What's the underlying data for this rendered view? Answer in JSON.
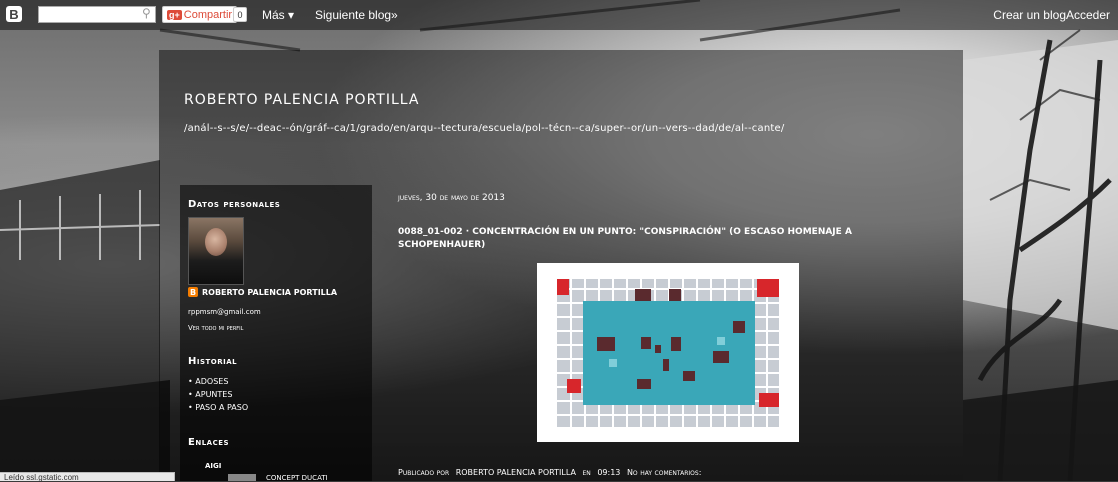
{
  "navbar": {
    "logo": "B",
    "search_placeholder": "",
    "share_label": "Compartir",
    "share_icon": "g+",
    "share_count": "0",
    "more_label": "Más ▾",
    "next_blog": "Siguiente blog»",
    "create_blog": "Crear un blog",
    "login": "Acceder"
  },
  "header": {
    "title": "ROBERTO PALENCIA PORTILLA",
    "description": "/anál--s--s/e/--deac--ón/gráf--ca/1/grado/en/arqu--tectura/escuela/pol--técn--ca/super--or/un--vers--dad/de/al--cante/"
  },
  "sidebar": {
    "profile_heading": "Datos personales",
    "profile_name": "ROBERTO PALENCIA PORTILLA",
    "profile_email": "rppmsm@gmail.com",
    "profile_link": "Ver todo mi perfil",
    "history_heading": "Historial",
    "history_items": [
      "ADOSES",
      "APUNTES",
      "PASO A PASO"
    ],
    "links_heading": "Enlaces",
    "link_image_label": "AIGI",
    "link_text": "CONCEPT DUCATI"
  },
  "post": {
    "date": "jueves, 30 de mayo de 2013",
    "title": "0088_01-002 · CONCENTRACIÓN EN UN PUNTO: \"CONSPIRACIÓN\" (O ESCASO HOMENAJE A SCHOPENHAUER)",
    "footer_author_prefix": "Publicado por",
    "footer_author": "ROBERTO PALENCIA PORTILLA",
    "footer_time_prefix": "en",
    "footer_time": "09:13",
    "footer_comments": "No hay comentarios:"
  },
  "status_bar": {
    "text": "Leído ssl.gstatic.com"
  },
  "colors": {
    "artwork_cyan": "#3aa7b8",
    "artwork_red": "#d7262b",
    "artwork_dark": "#5a2a2e",
    "artwork_grey": "#c7ccd3"
  }
}
